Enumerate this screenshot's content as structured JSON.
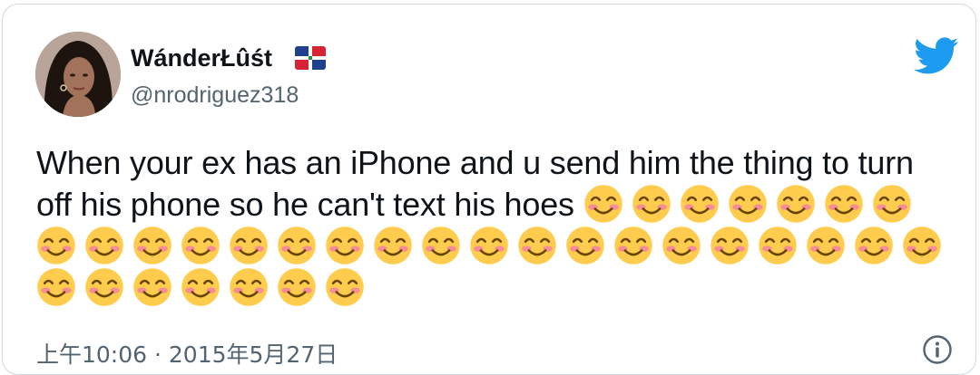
{
  "tweet": {
    "display_name": "WánderŁûśt",
    "flag_icon": "dominican-republic-flag",
    "handle": "@nrodriguez318",
    "text": "When your ex has an iPhone and u send him the thing to turn off his phone so he can't text his hoes",
    "emoji_name": "smiling-face-with-smiling-eyes",
    "emoji_count": 33,
    "timestamp": "上午10:06 · 2015年5月27日",
    "brand_icon": "twitter-bird-icon",
    "info_icon": "info-icon",
    "colors": {
      "brand": "#1d9bf0",
      "text": "#0f1419",
      "secondary": "#536471",
      "border": "#cfd9de"
    }
  }
}
